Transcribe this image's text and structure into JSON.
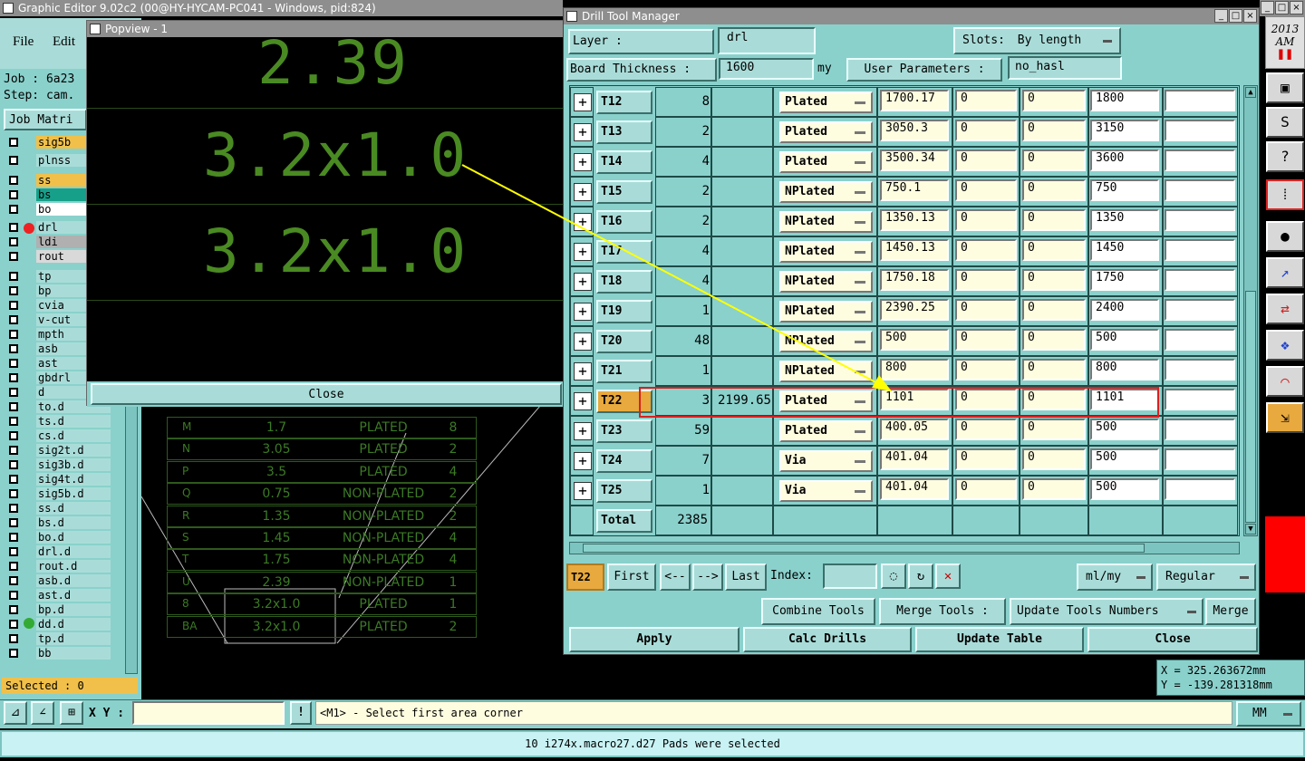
{
  "app": {
    "title": "Graphic Editor 9.02c2 (00@HY-HYCAM-PC041 - Windows, pid:824)",
    "menu": [
      "File",
      "Edit"
    ],
    "job": "Job : 6a23",
    "step": "Step: cam.",
    "job_matrix": "Job Matri",
    "selected": "Selected : 0"
  },
  "layers": [
    {
      "n": "sig5b",
      "c": "#f0c04a"
    },
    {
      "n": "plnss",
      "c": "#a9dcd8"
    },
    {
      "n": "ss",
      "c": "#f0c04a"
    },
    {
      "n": "bs",
      "c": "#16a08a"
    },
    {
      "n": "bo",
      "c": "#ffffff"
    },
    {
      "n": "drl",
      "c": "#a9dcd8"
    },
    {
      "n": "ldi",
      "c": "#b0b0b0"
    },
    {
      "n": "rout",
      "c": "#d9d9d9"
    },
    {
      "n": "tp",
      "c": "#a9dcd8"
    },
    {
      "n": "bp",
      "c": "#a9dcd8"
    },
    {
      "n": "cvia",
      "c": "#a9dcd8"
    },
    {
      "n": "v-cut",
      "c": "#a9dcd8"
    },
    {
      "n": "mpth",
      "c": "#a9dcd8"
    },
    {
      "n": "asb",
      "c": "#a9dcd8"
    },
    {
      "n": "ast",
      "c": "#a9dcd8"
    },
    {
      "n": "gbdrl",
      "c": "#a9dcd8"
    },
    {
      "n": "d",
      "c": "#a9dcd8"
    },
    {
      "n": "to.d",
      "c": "#a9dcd8"
    },
    {
      "n": "ts.d",
      "c": "#a9dcd8"
    },
    {
      "n": "cs.d",
      "c": "#a9dcd8"
    },
    {
      "n": "sig2t.d",
      "c": "#a9dcd8"
    },
    {
      "n": "sig3b.d",
      "c": "#a9dcd8"
    },
    {
      "n": "sig4t.d",
      "c": "#a9dcd8"
    },
    {
      "n": "sig5b.d",
      "c": "#a9dcd8"
    },
    {
      "n": "ss.d",
      "c": "#a9dcd8"
    },
    {
      "n": "bs.d",
      "c": "#a9dcd8"
    },
    {
      "n": "bo.d",
      "c": "#a9dcd8"
    },
    {
      "n": "drl.d",
      "c": "#a9dcd8"
    },
    {
      "n": "rout.d",
      "c": "#a9dcd8"
    },
    {
      "n": "asb.d",
      "c": "#a9dcd8"
    },
    {
      "n": "ast.d",
      "c": "#a9dcd8"
    },
    {
      "n": "bp.d",
      "c": "#a9dcd8"
    },
    {
      "n": "dd.d",
      "c": "#a9dcd8"
    },
    {
      "n": "tp.d",
      "c": "#a9dcd8"
    },
    {
      "n": "bb",
      "c": "#a9dcd8"
    }
  ],
  "popview": {
    "title": "Popview - 1",
    "texts": [
      "2.39",
      "3.2x1.0",
      "3.2x1.0"
    ],
    "close": "Close"
  },
  "bg_table": [
    {
      "sym": "M",
      "size": "1.7",
      "type": "PLATED",
      "n": "8"
    },
    {
      "sym": "N",
      "size": "3.05",
      "type": "PLATED",
      "n": "2"
    },
    {
      "sym": "P",
      "size": "3.5",
      "type": "PLATED",
      "n": "4"
    },
    {
      "sym": "Q",
      "size": "0.75",
      "type": "NON-PLATED",
      "n": "2"
    },
    {
      "sym": "R",
      "size": "1.35",
      "type": "NON-PLATED",
      "n": "2"
    },
    {
      "sym": "S",
      "size": "1.45",
      "type": "NON-PLATED",
      "n": "4"
    },
    {
      "sym": "T",
      "size": "1.75",
      "type": "NON-PLATED",
      "n": "4"
    },
    {
      "sym": "U",
      "size": "2.39",
      "type": "NON-PLATED",
      "n": "1"
    },
    {
      "sym": "8",
      "size": "3.2x1.0",
      "type": "PLATED",
      "n": "1"
    },
    {
      "sym": "BA",
      "size": "3.2x1.0",
      "type": "PLATED",
      "n": "2"
    }
  ],
  "dtm": {
    "title": "Drill Tool Manager",
    "layer_label": "Layer        :",
    "layer_value": "drl",
    "slots_label": "Slots:",
    "slots_value": "By length",
    "thickness_label": "Board Thickness :",
    "thickness_value": "1600",
    "thickness_unit": "my",
    "user_params_label": "User Parameters :",
    "user_params_value": "no_hasl",
    "rows": [
      {
        "t": "T12",
        "c": "8",
        "f": "",
        "type": "Plated",
        "v1": "1700.17",
        "v2": "0",
        "v3": "0",
        "v4": "1800",
        "v5": ""
      },
      {
        "t": "T13",
        "c": "2",
        "f": "",
        "type": "Plated",
        "v1": "3050.3",
        "v2": "0",
        "v3": "0",
        "v4": "3150",
        "v5": ""
      },
      {
        "t": "T14",
        "c": "4",
        "f": "",
        "type": "Plated",
        "v1": "3500.34",
        "v2": "0",
        "v3": "0",
        "v4": "3600",
        "v5": ""
      },
      {
        "t": "T15",
        "c": "2",
        "f": "",
        "type": "NPlated",
        "v1": "750.1",
        "v2": "0",
        "v3": "0",
        "v4": "750",
        "v5": ""
      },
      {
        "t": "T16",
        "c": "2",
        "f": "",
        "type": "NPlated",
        "v1": "1350.13",
        "v2": "0",
        "v3": "0",
        "v4": "1350",
        "v5": ""
      },
      {
        "t": "T17",
        "c": "4",
        "f": "",
        "type": "NPlated",
        "v1": "1450.13",
        "v2": "0",
        "v3": "0",
        "v4": "1450",
        "v5": ""
      },
      {
        "t": "T18",
        "c": "4",
        "f": "",
        "type": "NPlated",
        "v1": "1750.18",
        "v2": "0",
        "v3": "0",
        "v4": "1750",
        "v5": ""
      },
      {
        "t": "T19",
        "c": "1",
        "f": "",
        "type": "NPlated",
        "v1": "2390.25",
        "v2": "0",
        "v3": "0",
        "v4": "2400",
        "v5": ""
      },
      {
        "t": "T20",
        "c": "48",
        "f": "",
        "type": "NPlated",
        "v1": "500",
        "v2": "0",
        "v3": "0",
        "v4": "500",
        "v5": ""
      },
      {
        "t": "T21",
        "c": "1",
        "f": "",
        "type": "NPlated",
        "v1": "800",
        "v2": "0",
        "v3": "0",
        "v4": "800",
        "v5": ""
      },
      {
        "t": "T22",
        "c": "3",
        "f": "2199.65",
        "type": "Plated",
        "v1": "1101",
        "v2": "0",
        "v3": "0",
        "v4": "1101",
        "v5": ""
      },
      {
        "t": "T23",
        "c": "59",
        "f": "",
        "type": "Plated",
        "v1": "400.05",
        "v2": "0",
        "v3": "0",
        "v4": "500",
        "v5": ""
      },
      {
        "t": "T24",
        "c": "7",
        "f": "",
        "type": "Via",
        "v1": "401.04",
        "v2": "0",
        "v3": "0",
        "v4": "500",
        "v5": ""
      },
      {
        "t": "T25",
        "c": "1",
        "f": "",
        "type": "Via",
        "v1": "401.04",
        "v2": "0",
        "v3": "0",
        "v4": "500",
        "v5": ""
      }
    ],
    "total_label": "Total",
    "total_value": "2385",
    "current_tool": "T22",
    "nav": {
      "first": "First",
      "prev": "<--",
      "next": "-->",
      "last": "Last",
      "index": "Index:"
    },
    "units": "ml/my",
    "mode": "Regular",
    "combine": "Combine Tools",
    "merge_label": "Merge Tools :",
    "update_numbers": "Update Tools Numbers",
    "merge": "Merge",
    "apply": "Apply",
    "calc": "Calc Drills",
    "update_table": "Update Table",
    "close": "Close"
  },
  "status": {
    "xy_label": "X Y :",
    "prompt": "<M1> - Select first area corner",
    "unit": "MM",
    "message": "10 i274x.macro27.d27 Pads were selected",
    "x": "X = 325.263672mm",
    "y": "Y = -139.281318mm"
  },
  "clock": {
    "year": "2013",
    "ampm": "AM"
  },
  "colors": {
    "teal": "#8ad1cc",
    "button": "#a9dcd8",
    "input": "#fffde0",
    "highlight": "#e8a93e",
    "annot": "#d92020",
    "arrow": "#ffff00",
    "pcb_text": "#4a8a22"
  }
}
